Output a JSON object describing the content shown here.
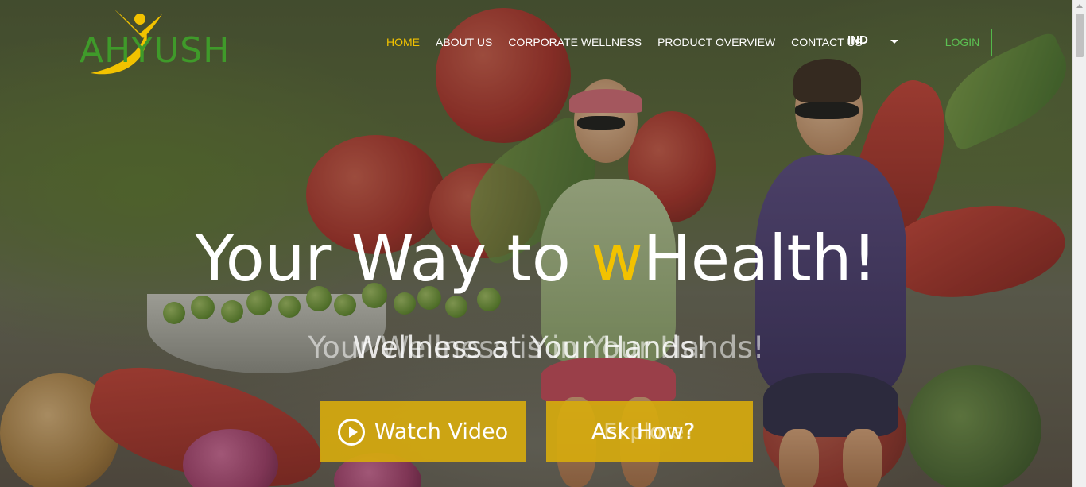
{
  "brand": {
    "logo_text": "AHYUSH"
  },
  "nav": {
    "items": [
      {
        "label": "HOME",
        "active": true
      },
      {
        "label": "ABOUT US",
        "active": false
      },
      {
        "label": "CORPORATE WELLNESS",
        "active": false
      },
      {
        "label": "PRODUCT OVERVIEW",
        "active": false
      },
      {
        "label": "CONTACT US",
        "active": false
      }
    ],
    "language": "IND",
    "login_label": "LOGIN"
  },
  "hero": {
    "headline_pre": "Your Way to ",
    "headline_accent": "w",
    "headline_post": "Health!",
    "subline_a": "Your Wellness is in Your Hands!",
    "subline_b": "Wellness at Your Hands!",
    "watch_label": "Watch Video",
    "ask_label": "Ask How?",
    "ask_ghost_label": "Explore?"
  },
  "colors": {
    "accent_yellow": "#f2c200",
    "brand_green": "#3f9a2a",
    "cta_bg": "#d6aa0e"
  },
  "icons": {
    "play": "play-circle-icon",
    "caret": "chevron-down-icon"
  }
}
